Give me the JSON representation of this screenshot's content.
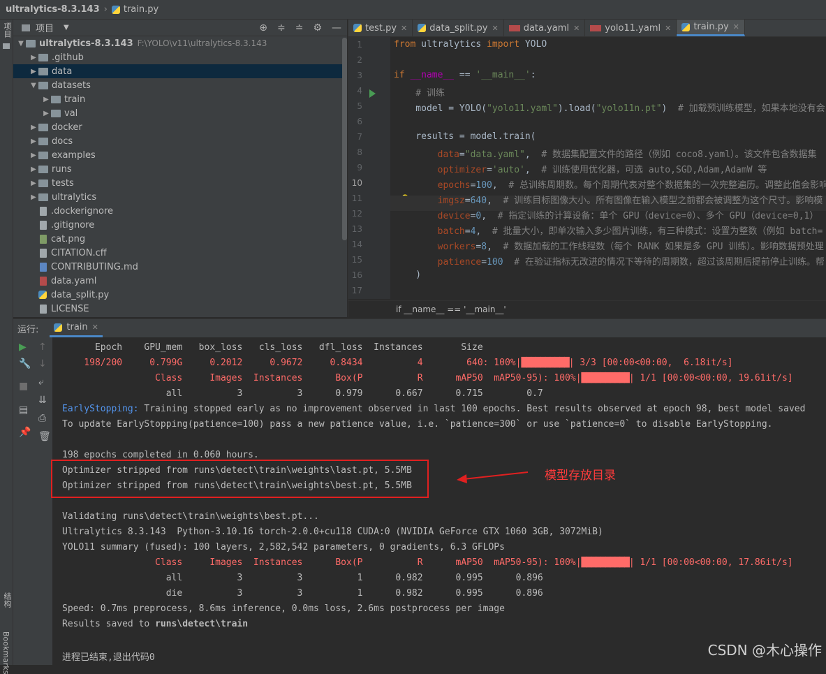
{
  "topbar": {
    "project": "ultralytics-8.3.143",
    "file": "train.py"
  },
  "left_strip": {
    "project_label": "项目",
    "structure_label": "结构",
    "bookmarks_label": "Bookmarks"
  },
  "project_panel": {
    "title": "项目",
    "root": {
      "name": "ultralytics-8.3.143",
      "path": "F:\\YOLO\\v11\\ultralytics-8.3.143"
    },
    "items": [
      {
        "name": ".github",
        "type": "folder"
      },
      {
        "name": "data",
        "type": "folder"
      },
      {
        "name": "datasets",
        "type": "folder"
      },
      {
        "name": "train",
        "type": "folder"
      },
      {
        "name": "val",
        "type": "folder"
      },
      {
        "name": "docker",
        "type": "folder"
      },
      {
        "name": "docs",
        "type": "folder"
      },
      {
        "name": "examples",
        "type": "folder"
      },
      {
        "name": "runs",
        "type": "folder"
      },
      {
        "name": "tests",
        "type": "folder"
      },
      {
        "name": "ultralytics",
        "type": "folder"
      },
      {
        "name": ".dockerignore",
        "type": "file"
      },
      {
        "name": ".gitignore",
        "type": "file"
      },
      {
        "name": "cat.png",
        "type": "file"
      },
      {
        "name": "CITATION.cff",
        "type": "file"
      },
      {
        "name": "CONTRIBUTING.md",
        "type": "file"
      },
      {
        "name": "data.yaml",
        "type": "file"
      },
      {
        "name": "data_split.py",
        "type": "file"
      },
      {
        "name": "LICENSE",
        "type": "file"
      }
    ]
  },
  "tabs": [
    "test.py",
    "data_split.py",
    "data.yaml",
    "yolo11.yaml",
    "train.py"
  ],
  "editor": {
    "line_numbers": [
      "1",
      "2",
      "3",
      "4",
      "5",
      "6",
      "7",
      "8",
      "9",
      "10",
      "11",
      "12",
      "13",
      "14",
      "15",
      "16",
      "17"
    ],
    "l1": {
      "kw1": "from",
      "mod": " ultralytics ",
      "kw2": "import",
      "cls": " YOLO"
    },
    "l3": {
      "kw": "if",
      "dn": " __name__",
      "op": " == ",
      "str": "'__main__'",
      "end": ":"
    },
    "l4": "    # 训练",
    "l5": {
      "a": "    model = YOLO(",
      "s1": "\"yolo11.yaml\"",
      "b": ").load(",
      "s2": "\"yolo11n.pt\"",
      "c": ")  ",
      "cmt": "# 加载预训练模型，如果本地没有会"
    },
    "l7": "    results = model.train(",
    "l8": {
      "p": "        data",
      "eq": "=",
      "v": "\"data.yaml\"",
      "c": ",  ",
      "cmt": "# 数据集配置文件的路径（例如 coco8.yaml）。该文件包含数据集"
    },
    "l9": {
      "p": "        optimizer",
      "eq": "=",
      "v": "'auto'",
      "c": ",  ",
      "cmt": "# 训练使用优化器，可选 auto,SGD,Adam,AdamW 等"
    },
    "l10": {
      "p": "        epochs",
      "eq": "=",
      "v": "100",
      "c": ",  ",
      "cmt": "# 总训练周期数。每个周期代表对整个数据集的一次完整遍历。调整此值会影响"
    },
    "l11": {
      "p": "        imgsz",
      "eq": "=",
      "v": "640",
      "c": ",  ",
      "cmt": "# 训练目标图像大小。所有图像在输入模型之前都会被调整为这个尺寸。影响模"
    },
    "l12": {
      "p": "        device",
      "eq": "=",
      "v": "0",
      "c": ",  ",
      "cmt": "# 指定训练的计算设备：单个 GPU（device=0）、多个 GPU（device=0,1）"
    },
    "l13": {
      "p": "        batch",
      "eq": "=",
      "v": "4",
      "c": ",  ",
      "cmt": "# 批量大小，即单次输入多少图片训练，有三种模式：设置为整数（例如 batch="
    },
    "l14": {
      "p": "        workers",
      "eq": "=",
      "v": "8",
      "c": ",  ",
      "cmt": "# 数据加载的工作线程数（每个 RANK 如果是多 GPU 训练）。影响数据预处理"
    },
    "l15": {
      "p": "        patience",
      "eq": "=",
      "v": "100",
      "c": "  ",
      "cmt": "# 在验证指标无改进的情况下等待的周期数，超过该周期后提前停止训练。帮"
    },
    "l16": "    )",
    "breadcrumb": "if __name__ == '__main__'"
  },
  "run": {
    "label": "运行:",
    "tab": "train"
  },
  "console": {
    "c1": "      Epoch    GPU_mem   box_loss   cls_loss   dfl_loss  Instances       Size",
    "c2a": "    198/200     0.799G     0.2012     0.9672     0.8434          4        640: 100%|",
    "c2bar": "██████████",
    "c2b": "| 3/3 [00:00<00:00,  6.18it/s]",
    "c3a": "                 Class     Images  Instances      Box(P          R      mAP50  mAP50-95): 100%|",
    "c3bar": "██████████",
    "c3b": "| 1/1 [00:00<00:00, 19.61it/s]",
    "c4": "                   all          3          3      0.979      0.667      0.715        0.7",
    "c5a": "EarlyStopping:",
    "c5b": " Training stopped early as no improvement observed in last 100 epochs. Best results observed at epoch 98, best model saved",
    "c6": "To update EarlyStopping(patience=100) pass a new patience value, i.e. `patience=300` or use `patience=0` to disable EarlyStopping.",
    "c7": "198 epochs completed in 0.060 hours.",
    "c8": "Optimizer stripped from runs\\detect\\train\\weights\\last.pt, 5.5MB",
    "c9": "Optimizer stripped from runs\\detect\\train\\weights\\best.pt, 5.5MB",
    "c10": "Validating runs\\detect\\train\\weights\\best.pt...",
    "c11": "Ultralytics 8.3.143  Python-3.10.16 torch-2.0.0+cu118 CUDA:0 (NVIDIA GeForce GTX 1060 3GB, 3072MiB)",
    "c12": "YOLO11 summary (fused): 100 layers, 2,582,542 parameters, 0 gradients, 6.3 GFLOPs",
    "c13a": "                 Class     Images  Instances      Box(P          R      mAP50  mAP50-95): 100%|",
    "c13bar": "██████████",
    "c13b": "| 1/1 [00:00<00:00, 17.86it/s]",
    "c14": "                   all          3          3          1      0.982      0.995      0.896",
    "c15": "                   die          3          3          1      0.982      0.995      0.896",
    "c16": "Speed: 0.7ms preprocess, 8.6ms inference, 0.0ms loss, 2.6ms postprocess per image",
    "c17a": "Results saved to ",
    "c17b": "runs\\detect\\train",
    "c18": "进程已结束,退出代码0"
  },
  "annotation": "模型存放目录",
  "watermark": "CSDN @木心操作"
}
